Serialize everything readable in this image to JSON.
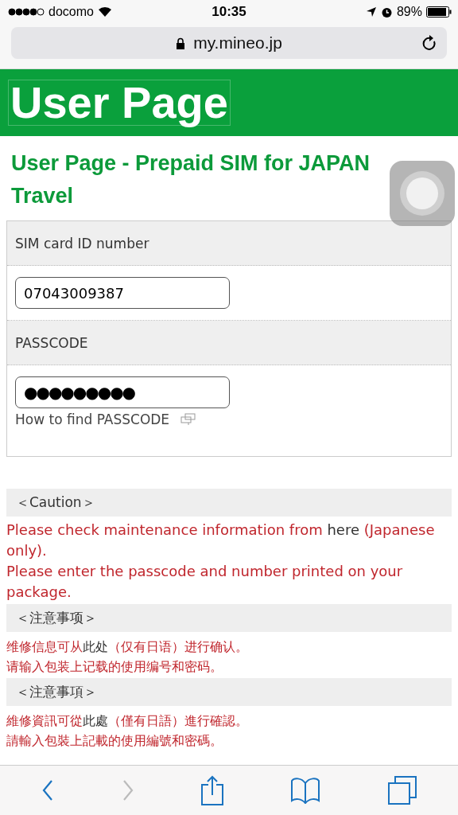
{
  "status_bar": {
    "carrier": "docomo",
    "time": "10:35",
    "battery": "89%"
  },
  "address_bar": {
    "url": "my.mineo.jp"
  },
  "header": {
    "title": "User Page"
  },
  "page_title": "User Page - Prepaid SIM for JAPAN Travel",
  "form": {
    "fields": [
      {
        "label": "SIM card ID number",
        "value": "07043009387"
      },
      {
        "label": "PASSCODE",
        "value": "●●●●●●●●●"
      }
    ],
    "help_link": "How to find PASSCODE"
  },
  "notices": [
    {
      "heading": "＜Caution＞",
      "lines": [
        {
          "before": "Please check maintenance information from ",
          "link": "here",
          "after": " (Japanese only)."
        },
        {
          "before": "Please enter the passcode and number printed on your package."
        }
      ]
    },
    {
      "heading": "＜注意事项＞",
      "lines": [
        {
          "before": "维修信息可从",
          "link": "此处",
          "after": "（仅有日语）进行确认。"
        },
        {
          "before": "请输入包装上记载的使用编号和密码。"
        }
      ]
    },
    {
      "heading": "＜注意事項＞",
      "lines": [
        {
          "before": "維修資訊可從",
          "link": "此處",
          "after": "（僅有日語）進行確認。"
        },
        {
          "before": "請輸入包裝上記載的使用編號和密碼。"
        }
      ]
    }
  ],
  "toolbar": {
    "back_disabled": false,
    "forward_disabled": true
  }
}
